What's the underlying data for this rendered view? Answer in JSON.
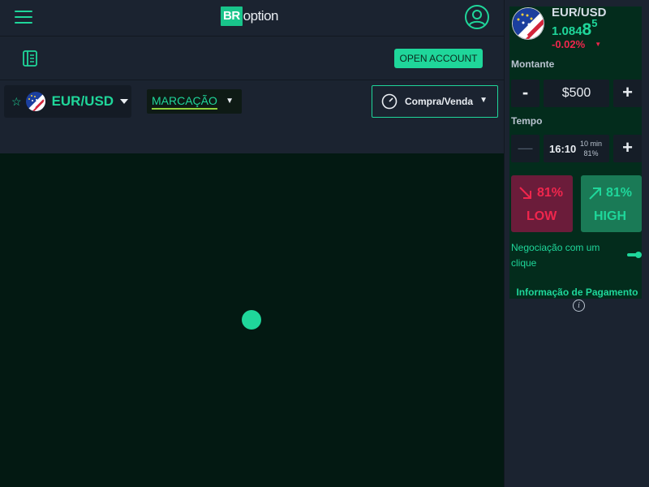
{
  "header": {
    "menu_icon": "hamburger-menu-icon",
    "logo_br": "BR",
    "logo_option": "option",
    "user_icon": "user-avatar-icon"
  },
  "toolbar": {
    "history_icon": "book-icon",
    "open_account_label": "OPEN ACCOUNT"
  },
  "asset_bar": {
    "favorite_icon": "star-icon",
    "pair": "EUR/USD",
    "chart_mode": "MARCAÇÃO",
    "trade_mode": "Compra/Venda"
  },
  "trade_panel": {
    "pair": "EUR/USD",
    "price_small": "1.084",
    "price_big": "8",
    "price_sup": "5",
    "change": "-0.02%",
    "change_arrow": "▼",
    "amount_label": "Montante",
    "amount_minus": "-",
    "amount_value": "$500",
    "amount_plus": "+",
    "time_label": "Tempo",
    "time_minus": "—",
    "time_value": "16:10",
    "time_duration": "10 min",
    "time_payout": "81%",
    "time_plus": "+",
    "low_pct": "81%",
    "low_label": "LOW",
    "high_pct": "81%",
    "high_label": "HIGH",
    "one_click_label": "Negociação com um clique",
    "payment_info": "Informação de Pagamento",
    "info_icon": "i"
  },
  "colors": {
    "accent": "#1fd69a",
    "down": "#f0264d",
    "background": "#1b2330",
    "chart_bg": "#031912"
  }
}
